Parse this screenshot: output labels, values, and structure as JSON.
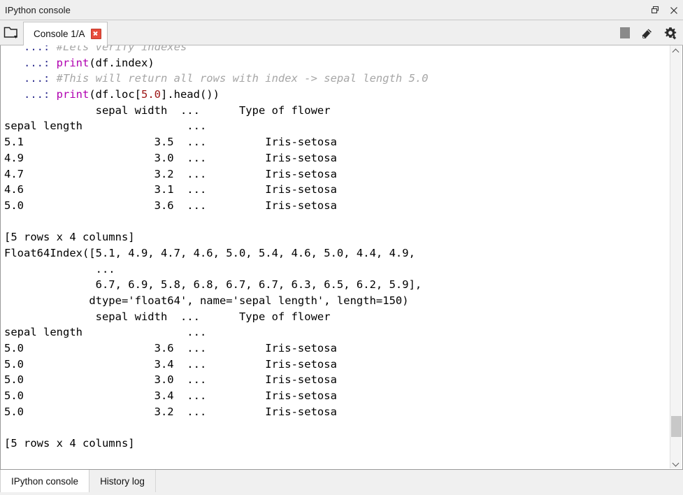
{
  "window": {
    "title": "IPython console",
    "restore_icon": "restore-window-icon",
    "close_icon": "close-window-icon"
  },
  "toolbar": {
    "browse_icon": "browse-tabs-folder-icon",
    "tab_label": "Console 1/A",
    "tab_close_icon": "close-tab-icon",
    "stop_icon": "stop-interrupt-icon",
    "clear_icon": "clear-console-eraser-icon",
    "options_icon": "options-gear-icon"
  },
  "console": {
    "lines": [
      {
        "id": "l01",
        "segments": [
          {
            "cls": "prompt",
            "text": "   ...: "
          },
          {
            "cls": "comment",
            "text": "#Lets verify indexes"
          }
        ]
      },
      {
        "id": "l02",
        "segments": [
          {
            "cls": "prompt",
            "text": "   ...: "
          },
          {
            "cls": "kw",
            "text": "print"
          },
          {
            "cls": "plain",
            "text": "(df.index)"
          }
        ]
      },
      {
        "id": "l03",
        "segments": [
          {
            "cls": "prompt",
            "text": "   ...: "
          },
          {
            "cls": "comment",
            "text": "#This will return all rows with index -> sepal length 5.0"
          }
        ]
      },
      {
        "id": "l04",
        "segments": [
          {
            "cls": "prompt",
            "text": "   ...: "
          },
          {
            "cls": "kw",
            "text": "print"
          },
          {
            "cls": "plain",
            "text": "(df.loc["
          },
          {
            "cls": "num",
            "text": "5.0"
          },
          {
            "cls": "plain",
            "text": "].head())"
          }
        ]
      },
      {
        "id": "l05",
        "segments": [
          {
            "cls": "plain",
            "text": "              sepal width  ...      Type of flower"
          }
        ]
      },
      {
        "id": "l06",
        "segments": [
          {
            "cls": "plain",
            "text": "sepal length                ...                    "
          }
        ]
      },
      {
        "id": "l07",
        "segments": [
          {
            "cls": "plain",
            "text": "5.1                    3.5  ...         Iris-setosa"
          }
        ]
      },
      {
        "id": "l08",
        "segments": [
          {
            "cls": "plain",
            "text": "4.9                    3.0  ...         Iris-setosa"
          }
        ]
      },
      {
        "id": "l09",
        "segments": [
          {
            "cls": "plain",
            "text": "4.7                    3.2  ...         Iris-setosa"
          }
        ]
      },
      {
        "id": "l10",
        "segments": [
          {
            "cls": "plain",
            "text": "4.6                    3.1  ...         Iris-setosa"
          }
        ]
      },
      {
        "id": "l11",
        "segments": [
          {
            "cls": "plain",
            "text": "5.0                    3.6  ...         Iris-setosa"
          }
        ]
      },
      {
        "id": "l12",
        "segments": [
          {
            "cls": "plain",
            "text": ""
          }
        ]
      },
      {
        "id": "l13",
        "segments": [
          {
            "cls": "plain",
            "text": "[5 rows x 4 columns]"
          }
        ]
      },
      {
        "id": "l14",
        "segments": [
          {
            "cls": "plain",
            "text": "Float64Index([5.1, 4.9, 4.7, 4.6, 5.0, 5.4, 4.6, 5.0, 4.4, 4.9,"
          }
        ]
      },
      {
        "id": "l15",
        "segments": [
          {
            "cls": "plain",
            "text": "              ..."
          }
        ]
      },
      {
        "id": "l16",
        "segments": [
          {
            "cls": "plain",
            "text": "              6.7, 6.9, 5.8, 6.8, 6.7, 6.7, 6.3, 6.5, 6.2, 5.9],"
          }
        ]
      },
      {
        "id": "l17",
        "segments": [
          {
            "cls": "plain",
            "text": "             dtype='float64', name='sepal length', length=150)"
          }
        ]
      },
      {
        "id": "l18",
        "segments": [
          {
            "cls": "plain",
            "text": "              sepal width  ...      Type of flower"
          }
        ]
      },
      {
        "id": "l19",
        "segments": [
          {
            "cls": "plain",
            "text": "sepal length                ...                    "
          }
        ]
      },
      {
        "id": "l20",
        "segments": [
          {
            "cls": "plain",
            "text": "5.0                    3.6  ...         Iris-setosa"
          }
        ]
      },
      {
        "id": "l21",
        "segments": [
          {
            "cls": "plain",
            "text": "5.0                    3.4  ...         Iris-setosa"
          }
        ]
      },
      {
        "id": "l22",
        "segments": [
          {
            "cls": "plain",
            "text": "5.0                    3.0  ...         Iris-setosa"
          }
        ]
      },
      {
        "id": "l23",
        "segments": [
          {
            "cls": "plain",
            "text": "5.0                    3.4  ...         Iris-setosa"
          }
        ]
      },
      {
        "id": "l24",
        "segments": [
          {
            "cls": "plain",
            "text": "5.0                    3.2  ...         Iris-setosa"
          }
        ]
      },
      {
        "id": "l25",
        "segments": [
          {
            "cls": "plain",
            "text": ""
          }
        ]
      },
      {
        "id": "l26",
        "segments": [
          {
            "cls": "plain",
            "text": "[5 rows x 4 columns]"
          }
        ]
      }
    ],
    "scroll": {
      "up_icon": "scroll-up-arrow-icon",
      "down_icon": "scroll-down-arrow-icon"
    }
  },
  "bottom_tabs": [
    {
      "label": "IPython console",
      "active": true
    },
    {
      "label": "History log",
      "active": false
    }
  ],
  "colors": {
    "prompt": "#2e2e8f",
    "keyword": "#b000b0",
    "number": "#9c1414",
    "comment": "#a6a6a6",
    "close_tab": "#e74c3c",
    "console_bg": "#ffffff",
    "chrome_bg": "#efefef"
  }
}
